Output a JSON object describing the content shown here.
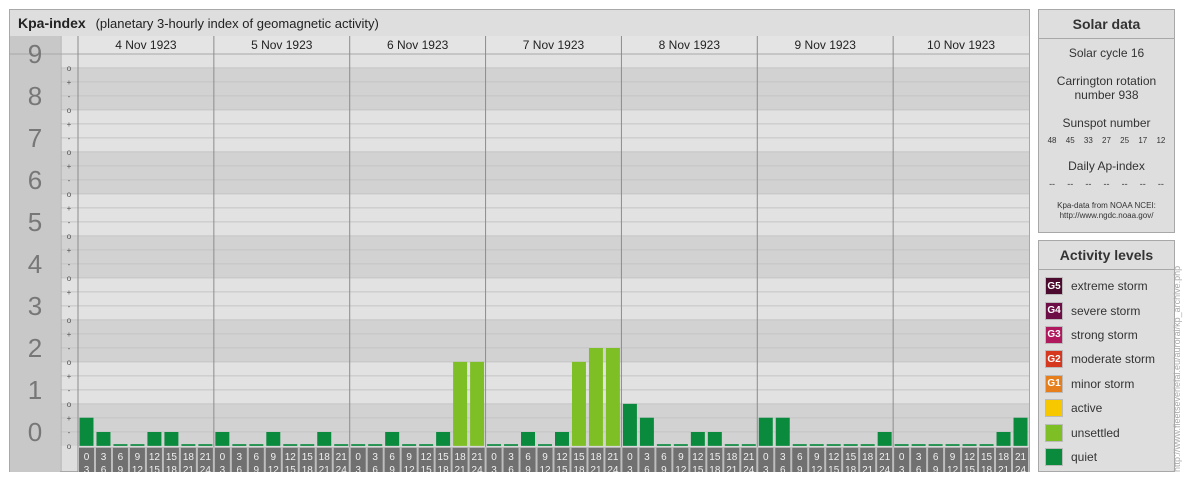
{
  "header": {
    "title": "Kpa-index",
    "subtitle": "(planetary 3-hourly index of geomagnetic activity)"
  },
  "solar": {
    "title": "Solar data",
    "cycle": "Solar cycle 16",
    "carrington_line1": "Carrington rotation",
    "carrington_line2": "number 938",
    "sunspot_title": "Sunspot number",
    "sunspot_values": [
      "48",
      "45",
      "33",
      "27",
      "25",
      "17",
      "12"
    ],
    "ap_title": "Daily Ap-index",
    "ap_values": [
      "--",
      "--",
      "--",
      "--",
      "--",
      "--",
      "--"
    ],
    "credit_line1": "Kpa-data from NOAA NCEI:",
    "credit_line2": "http://www.ngdc.noaa.gov/"
  },
  "activity": {
    "title": "Activity levels",
    "levels": [
      {
        "badge": "G5",
        "label": "extreme storm",
        "color": "#4b0a2e"
      },
      {
        "badge": "G4",
        "label": "severe storm",
        "color": "#6e0e46"
      },
      {
        "badge": "G3",
        "label": "strong storm",
        "color": "#b0195e"
      },
      {
        "badge": "G2",
        "label": "moderate storm",
        "color": "#d5371f"
      },
      {
        "badge": "G1",
        "label": "minor storm",
        "color": "#e67e1c"
      },
      {
        "badge": "",
        "label": "active",
        "color": "#f7c800"
      },
      {
        "badge": "",
        "label": "unsettled",
        "color": "#7fbf26"
      },
      {
        "badge": "",
        "label": "quiet",
        "color": "#0a8a3d"
      }
    ]
  },
  "vertical_credit": "http://www.fleetseveriefal.eu/auroral/kp_archive.php",
  "chart_data": {
    "type": "bar",
    "y_levels": [
      "0",
      "1",
      "2",
      "3",
      "4",
      "5",
      "6",
      "7",
      "8",
      "9"
    ],
    "y_sublabels": [
      "+",
      "o",
      "-"
    ],
    "ylim": [
      0,
      9.33
    ],
    "days": [
      "4 Nov 1923",
      "5 Nov 1923",
      "6 Nov 1923",
      "7 Nov 1923",
      "8 Nov 1923",
      "9 Nov 1923",
      "10 Nov 1923"
    ],
    "hour_start": [
      "0",
      "3",
      "6",
      "9",
      "12",
      "15",
      "18",
      "21"
    ],
    "hour_end": [
      "3",
      "6",
      "9",
      "12",
      "15",
      "18",
      "21",
      "24"
    ],
    "values": [
      [
        0.67,
        0.33,
        0,
        0,
        0.33,
        0.33,
        0,
        0
      ],
      [
        0.33,
        0,
        0,
        0.33,
        0,
        0,
        0.33,
        0
      ],
      [
        0,
        0,
        0.33,
        0,
        0,
        0.33,
        2,
        2
      ],
      [
        0,
        0,
        0.33,
        0,
        0.33,
        2,
        2.33,
        2.33
      ],
      [
        1,
        0.67,
        0,
        0,
        0.33,
        0.33,
        0,
        0
      ],
      [
        0.67,
        0.67,
        0,
        0,
        0,
        0,
        0,
        0.33
      ],
      [
        0,
        0,
        0,
        0,
        0,
        0,
        0.33,
        0.67
      ]
    ],
    "colors": {
      "quiet": "#0a8a3d",
      "unsettled": "#7fbf26",
      "active": "#f7c800"
    }
  }
}
